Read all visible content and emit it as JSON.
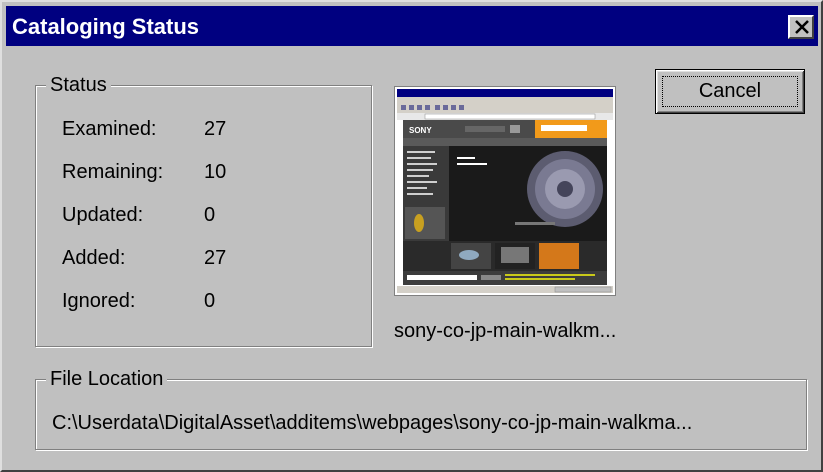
{
  "window": {
    "title": "Cataloging Status",
    "close_symbol": "close-icon"
  },
  "status": {
    "legend": "Status",
    "rows": [
      {
        "label": "Examined:",
        "value": "27"
      },
      {
        "label": "Remaining:",
        "value": "10"
      },
      {
        "label": "Updated:",
        "value": "0"
      },
      {
        "label": "Added:",
        "value": "27"
      },
      {
        "label": "Ignored:",
        "value": "0"
      }
    ]
  },
  "preview": {
    "caption": "sony-co-jp-main-walkm...",
    "thumb_brand": "SONY"
  },
  "buttons": {
    "cancel_label": "Cancel"
  },
  "file_location": {
    "legend": "File Location",
    "path": "C:\\Userdata\\DigitalAsset\\additems\\webpages\\sony-co-jp-main-walkma..."
  },
  "colors": {
    "title_bar": "#000080",
    "face": "#c0c0c0"
  }
}
